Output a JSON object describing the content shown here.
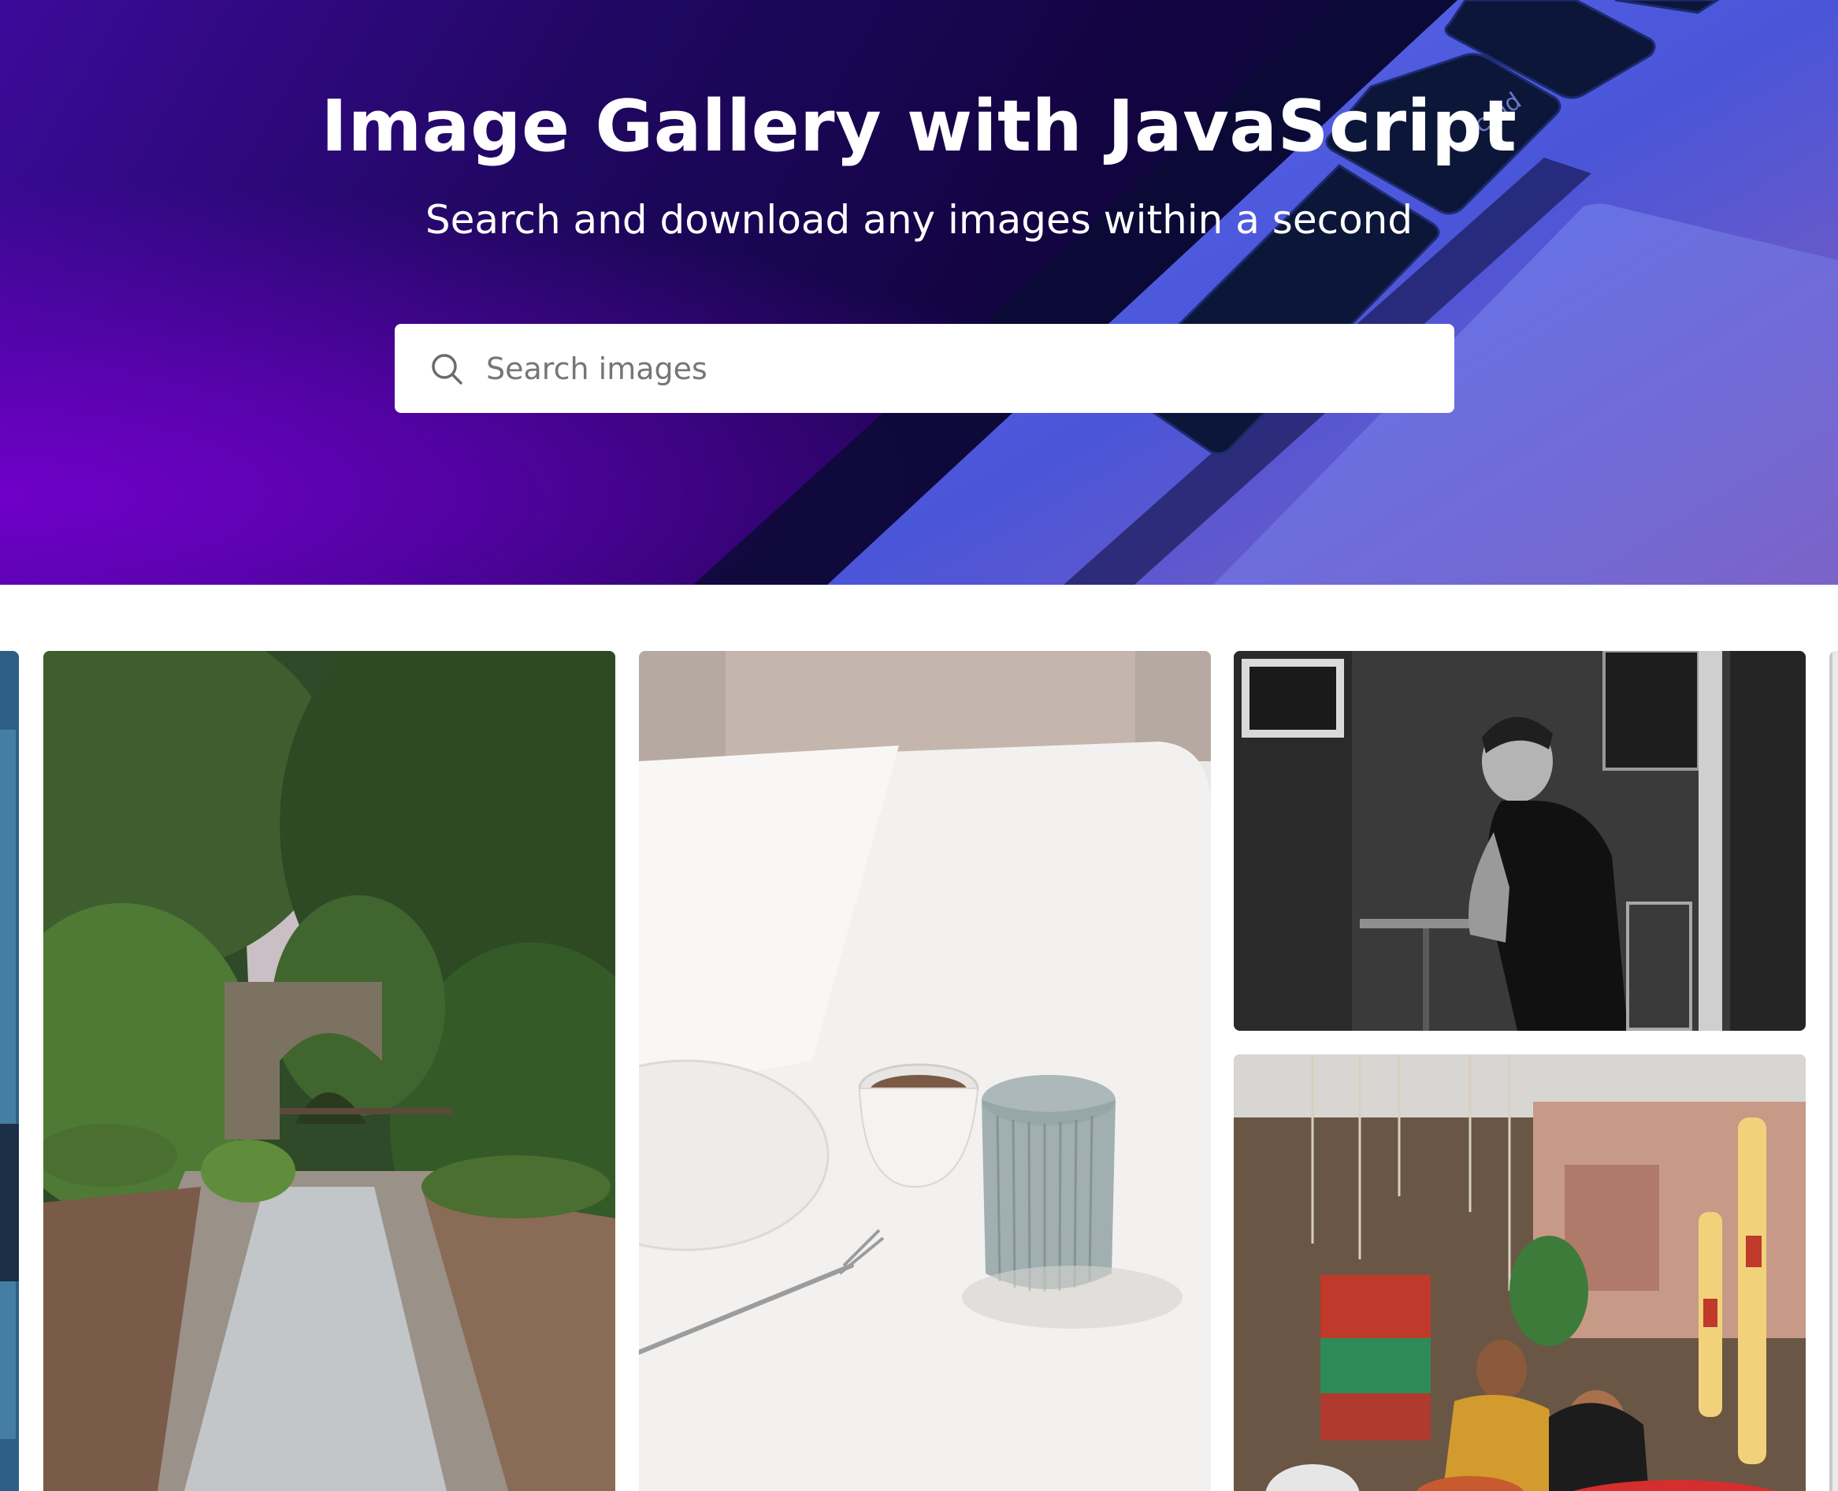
{
  "hero": {
    "title": "Image Gallery with JavaScript",
    "subtitle": "Search and download any images within a second",
    "background_colors": [
      "#6f00c8",
      "#1f0760",
      "#0d0a3a",
      "#3a4fd0"
    ]
  },
  "search": {
    "placeholder": "Search images",
    "value": "",
    "icon": "search-icon"
  },
  "gallery": {
    "images": [
      {
        "name": "partial-image-left",
        "description_icon": "image-icon"
      },
      {
        "name": "river-bridge-forest",
        "description_icon": "image-icon"
      },
      {
        "name": "coffee-cup-glass-table",
        "description_icon": "image-icon"
      },
      {
        "name": "man-in-cafe-bw",
        "description_icon": "image-icon"
      },
      {
        "name": "flower-market-vendors",
        "description_icon": "image-icon"
      },
      {
        "name": "partial-image-right",
        "description_icon": "image-icon"
      }
    ]
  }
}
